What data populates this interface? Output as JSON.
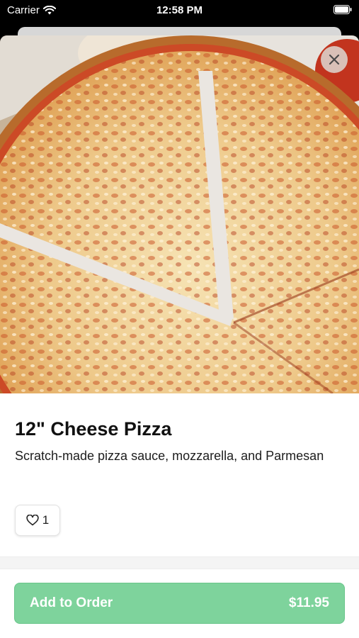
{
  "status_bar": {
    "carrier": "Carrier",
    "time": "12:58 PM"
  },
  "item": {
    "name": "12\" Cheese Pizza",
    "description": "Scratch-made pizza sauce, mozzarella, and Parmesan",
    "likes": "1",
    "price": "$11.95"
  },
  "actions": {
    "add_label": "Add to Order"
  },
  "icons": {
    "close": "close-icon",
    "like": "heart-icon",
    "wifi": "wifi-icon",
    "battery": "battery-icon"
  },
  "colors": {
    "primary_button": "#7ed39c",
    "text": "#111111"
  }
}
